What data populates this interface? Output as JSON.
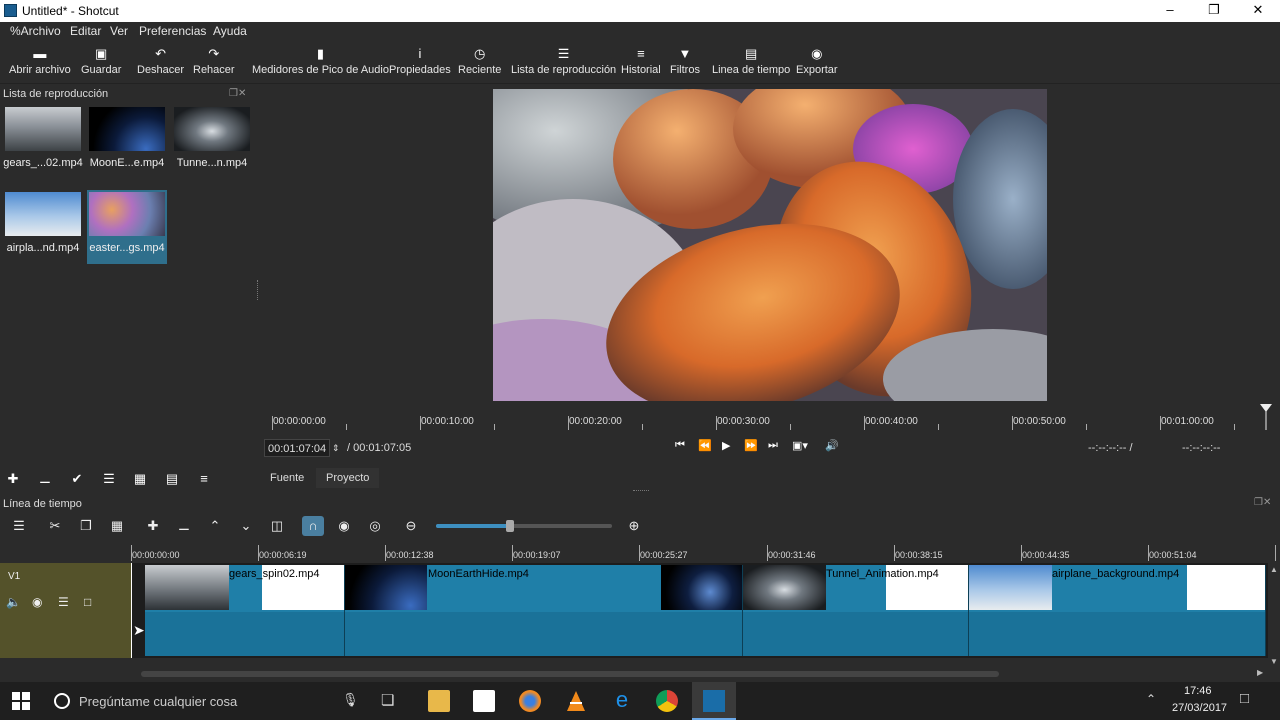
{
  "window": {
    "title": "Untitled* - Shotcut"
  },
  "menu": [
    "%Archivo",
    "Editar",
    "Ver",
    "Preferencias",
    "Ayuda"
  ],
  "toolbar": [
    {
      "label": "Abrir archivo",
      "icon": "folder-open-icon"
    },
    {
      "label": "Guardar",
      "icon": "save-icon"
    },
    {
      "label": "Deshacer",
      "icon": "undo-icon"
    },
    {
      "label": "Rehacer",
      "icon": "redo-icon"
    },
    {
      "label": "Medidores de Pico de Audio",
      "icon": "audio-meter-icon"
    },
    {
      "label": "Propiedades",
      "icon": "info-icon"
    },
    {
      "label": "Reciente",
      "icon": "clock-icon"
    },
    {
      "label": "Lista de reproducción",
      "icon": "list-icon"
    },
    {
      "label": "Historial",
      "icon": "history-icon"
    },
    {
      "label": "Filtros",
      "icon": "funnel-icon"
    },
    {
      "label": "Linea de tiempo",
      "icon": "timeline-icon"
    },
    {
      "label": "Exportar",
      "icon": "export-icon"
    }
  ],
  "playlist": {
    "title": "Lista de reproducción",
    "items": [
      {
        "label": "gears_...02.mp4"
      },
      {
        "label": "MoonE...e.mp4"
      },
      {
        "label": "Tunne...n.mp4"
      },
      {
        "label": "airpla...nd.mp4"
      },
      {
        "label": "easter...gs.mp4"
      }
    ],
    "selected_index": 4
  },
  "player": {
    "ruler": [
      "00:00:00:00",
      "00:00:10:00",
      "00:00:20:00",
      "00:00:30:00",
      "00:00:40:00",
      "00:00:50:00",
      "00:01:00:00"
    ],
    "timecode": "00:01:07:04",
    "duration": "/ 00:01:07:05",
    "in_point": "--:--:--:-- /",
    "out_point": "--:--:--:--",
    "tabs": [
      "Fuente",
      "Proyecto"
    ]
  },
  "timeline": {
    "title": "Línea de tiempo",
    "ruler": [
      "00:00:00:00",
      "00:00:06:19",
      "00:00:12:38",
      "00:00:19:07",
      "00:00:25:27",
      "00:00:31:46",
      "00:00:38:15",
      "00:00:44:35",
      "00:00:51:04"
    ],
    "track_name": "V1",
    "clips": [
      {
        "name": "gears_spin02.mp4"
      },
      {
        "name": "MoonEarthHide.mp4"
      },
      {
        "name": "Tunnel_Animation.mp4"
      },
      {
        "name": "airplane_background.mp4"
      }
    ]
  },
  "taskbar": {
    "search_placeholder": "Pregúntame cualquier cosa",
    "time": "17:46",
    "date": "27/03/2017"
  },
  "colors": {
    "clip": "#1f7fa8",
    "track_header": "#54522a",
    "selection": "#2f6f8c"
  }
}
